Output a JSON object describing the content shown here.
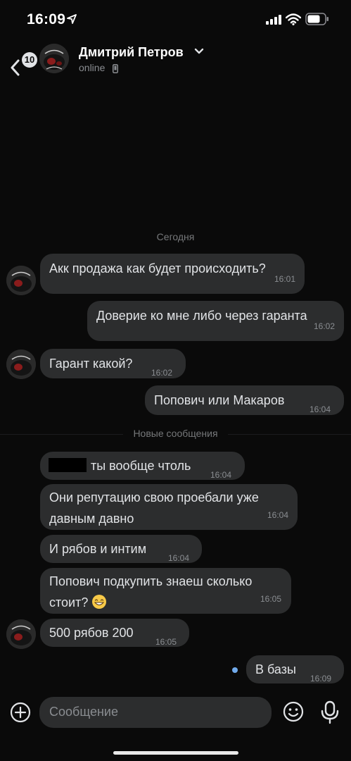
{
  "status_bar": {
    "time": "16:09"
  },
  "header": {
    "back_badge": "10",
    "contact_name": "Дмитрий Петров",
    "contact_status": "online"
  },
  "date_separator": "Сегодня",
  "new_messages_label": "Новые сообщения",
  "messages": [
    {
      "text": "Акк продажа как будет происходить?",
      "time": "16:01",
      "direction": "in"
    },
    {
      "text": "Доверие ко мне либо через гаранта",
      "time": "16:02",
      "direction": "out"
    },
    {
      "text": "Гарант какой?",
      "time": "16:02",
      "direction": "in"
    },
    {
      "text": "Попович или Макаров",
      "time": "16:04",
      "direction": "out"
    },
    {
      "text": "ты вообще чтоль",
      "time": "16:04",
      "direction": "in"
    },
    {
      "text": "Они репутацию свою проебали уже давным давно",
      "time": "16:04",
      "direction": "in"
    },
    {
      "text": "И рябов и интим",
      "time": "16:04",
      "direction": "in"
    },
    {
      "text": "Попович подкупить знаеш сколько стоит?",
      "time": "16:05",
      "direction": "in"
    },
    {
      "text": "500 рябов 200",
      "time": "16:05",
      "direction": "in"
    },
    {
      "text": "В базы",
      "time": "16:09",
      "direction": "out"
    }
  ],
  "composer": {
    "placeholder": "Сообщение"
  },
  "colors": {
    "background": "#0a0a0a",
    "bubble": "#2c2d2e",
    "accent": "#71aaeb",
    "secondary_text": "#8a8d91"
  },
  "icons": [
    "location-arrow-icon",
    "signal-icon",
    "wifi-icon",
    "battery-icon",
    "back-chevron-icon",
    "chevron-down-icon",
    "phone-icon",
    "grinning-emoji-icon",
    "plus-icon",
    "smile-icon",
    "microphone-icon"
  ]
}
